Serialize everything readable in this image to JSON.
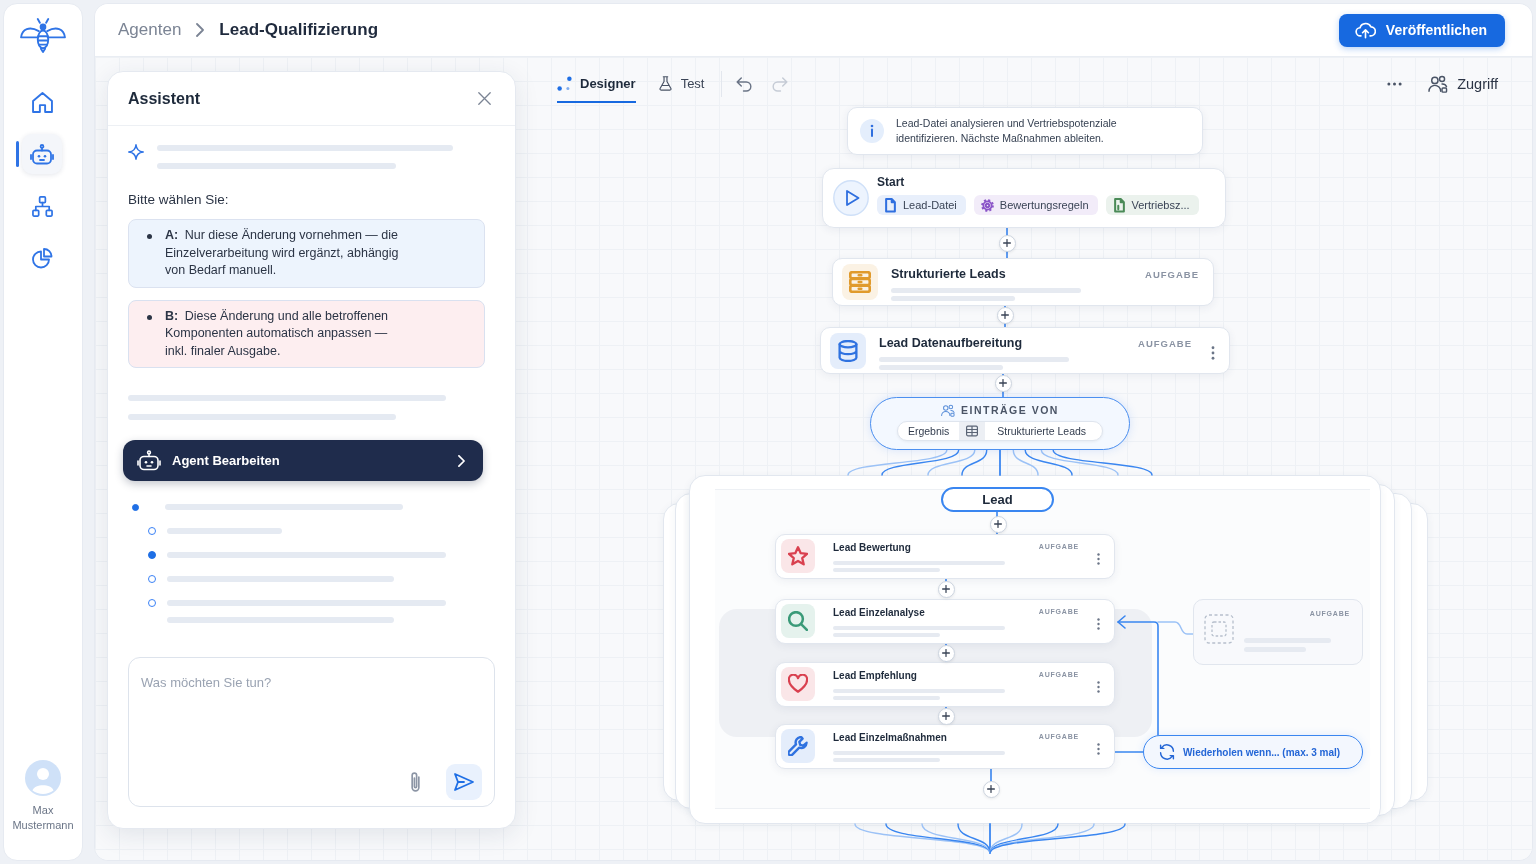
{
  "sidebar": {
    "nav_items": [
      {
        "kind": "home",
        "selected": false
      },
      {
        "kind": "agents",
        "selected": true
      },
      {
        "kind": "workflows",
        "selected": false
      },
      {
        "kind": "reports",
        "selected": false
      }
    ],
    "user": {
      "name": "Max Mustermann"
    }
  },
  "header": {
    "breadcrumb": [
      "Agenten",
      "Lead-Qualifizierung"
    ],
    "publish_button": "Veröffentlichen"
  },
  "assistant": {
    "title": "Assistent",
    "prompt": "Bitte wählen Sie:",
    "options": [
      {
        "text": "**A:** Nur diese Änderung vornehmen — die Einzelverarbeitung wird ergänzt, abhängig von Bedarf manuell.",
        "color": "#edf4fd"
      },
      {
        "text": "**B:** Diese Änderung und alle betroffenen Komponenten automatisch anpassen — inkl. finaler Ausgabe.",
        "color": "#fdeef0"
      }
    ],
    "action_button": "Agent Bearbeiten",
    "steps": [
      {
        "done": true,
        "children": [
          {
            "done": false
          },
          {
            "done": true
          },
          {
            "done": false
          },
          {
            "done": false
          }
        ]
      }
    ],
    "input": {
      "placeholder": "Was möchten Sie tun?"
    }
  },
  "toolbar": {
    "tabs": [
      {
        "kind": "designer",
        "label": "Designer",
        "selected": true
      },
      {
        "kind": "test",
        "label": "Test",
        "selected": false
      }
    ],
    "history": [
      {
        "kind": "undo",
        "disabled": false
      },
      {
        "kind": "redo",
        "disabled": true
      }
    ],
    "access_button": "Zugriff"
  },
  "canvas": {
    "note": "Lead-Datei analysieren und Vertriebspotenziale identifizieren. Nächste Maßnahmen ableiten.",
    "start": {
      "title": "Start",
      "inputs": [
        {
          "kind": "file",
          "label": "Lead-Datei",
          "color": "#2f6fdf"
        },
        {
          "kind": "rules",
          "label": "Bewertungsregeln",
          "color": "#8b55c8"
        },
        {
          "kind": "sheet",
          "label": "Vertriebsz...",
          "color": "#4a8a57"
        }
      ]
    },
    "tasks": [
      {
        "kind": "stack",
        "title": "Strukturierte Leads",
        "tag": "AUFGABE",
        "color": "#e09a2c",
        "has_menu": false
      },
      {
        "kind": "database",
        "title": "Lead Datenaufbereitung",
        "tag": "AUFGABE",
        "color": "#2f72e0",
        "has_menu": true
      }
    ],
    "collector": {
      "label": "EINTRÄGE VON",
      "field": "Ergebnis",
      "source": "Strukturierte Leads"
    },
    "group": {
      "title": "Lead",
      "tasks": [
        {
          "kind": "star",
          "title": "Lead Bewertung",
          "tag": "AUFGABE",
          "color": "#d9404f",
          "has_menu": true
        },
        {
          "kind": "search",
          "title": "Lead Einzelanalyse",
          "tag": "AUFGABE",
          "color": "#3a9a78",
          "has_menu": true
        },
        {
          "kind": "heart",
          "title": "Lead Empfehlung",
          "tag": "AUFGABE",
          "color": "#d9404f",
          "has_menu": true
        },
        {
          "kind": "wrench",
          "title": "Lead Einzelmaßnahmen",
          "tag": "AUFGABE",
          "color": "#2f72e0",
          "has_menu": true
        }
      ]
    },
    "placeholder_task": {
      "tag": "AUFGABE"
    },
    "loop": {
      "label": "Wiederholen wenn... (max. 3 mal)"
    }
  }
}
